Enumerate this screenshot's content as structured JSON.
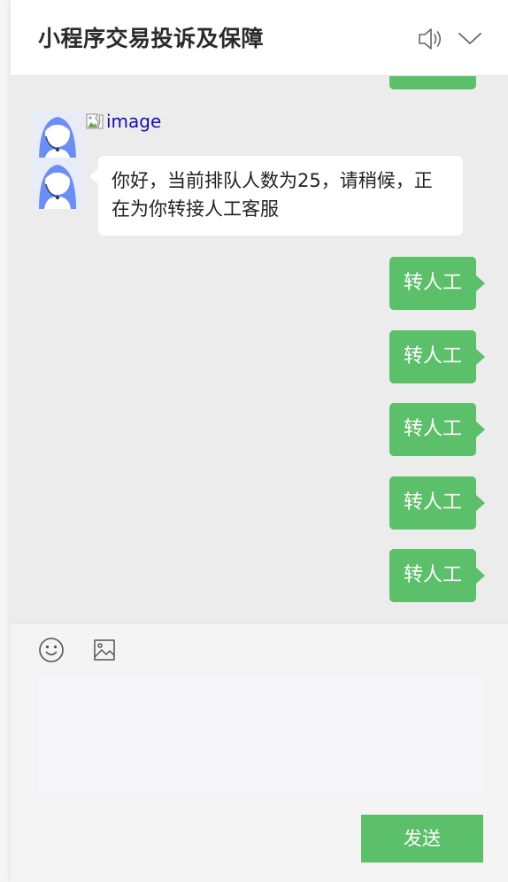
{
  "header": {
    "title": "小程序交易投诉及保障",
    "icons": [
      "speaker-icon",
      "chevron-down-icon"
    ]
  },
  "chat": {
    "broken_image_alt": "image",
    "agent_message": "你好，当前排队人数为25，请稍候，正在为你转接人工客服",
    "user_messages": [
      "转人工",
      "转人工",
      "转人工",
      "转人工",
      "转人工"
    ]
  },
  "composer": {
    "icons": [
      "emoji-icon",
      "image-icon"
    ],
    "input_value": "",
    "send_label": "发送"
  },
  "colors": {
    "accent": "#5cbf69",
    "chat_background": "#ececec",
    "header_background": "#ffffff",
    "link": "#1a0dab"
  }
}
